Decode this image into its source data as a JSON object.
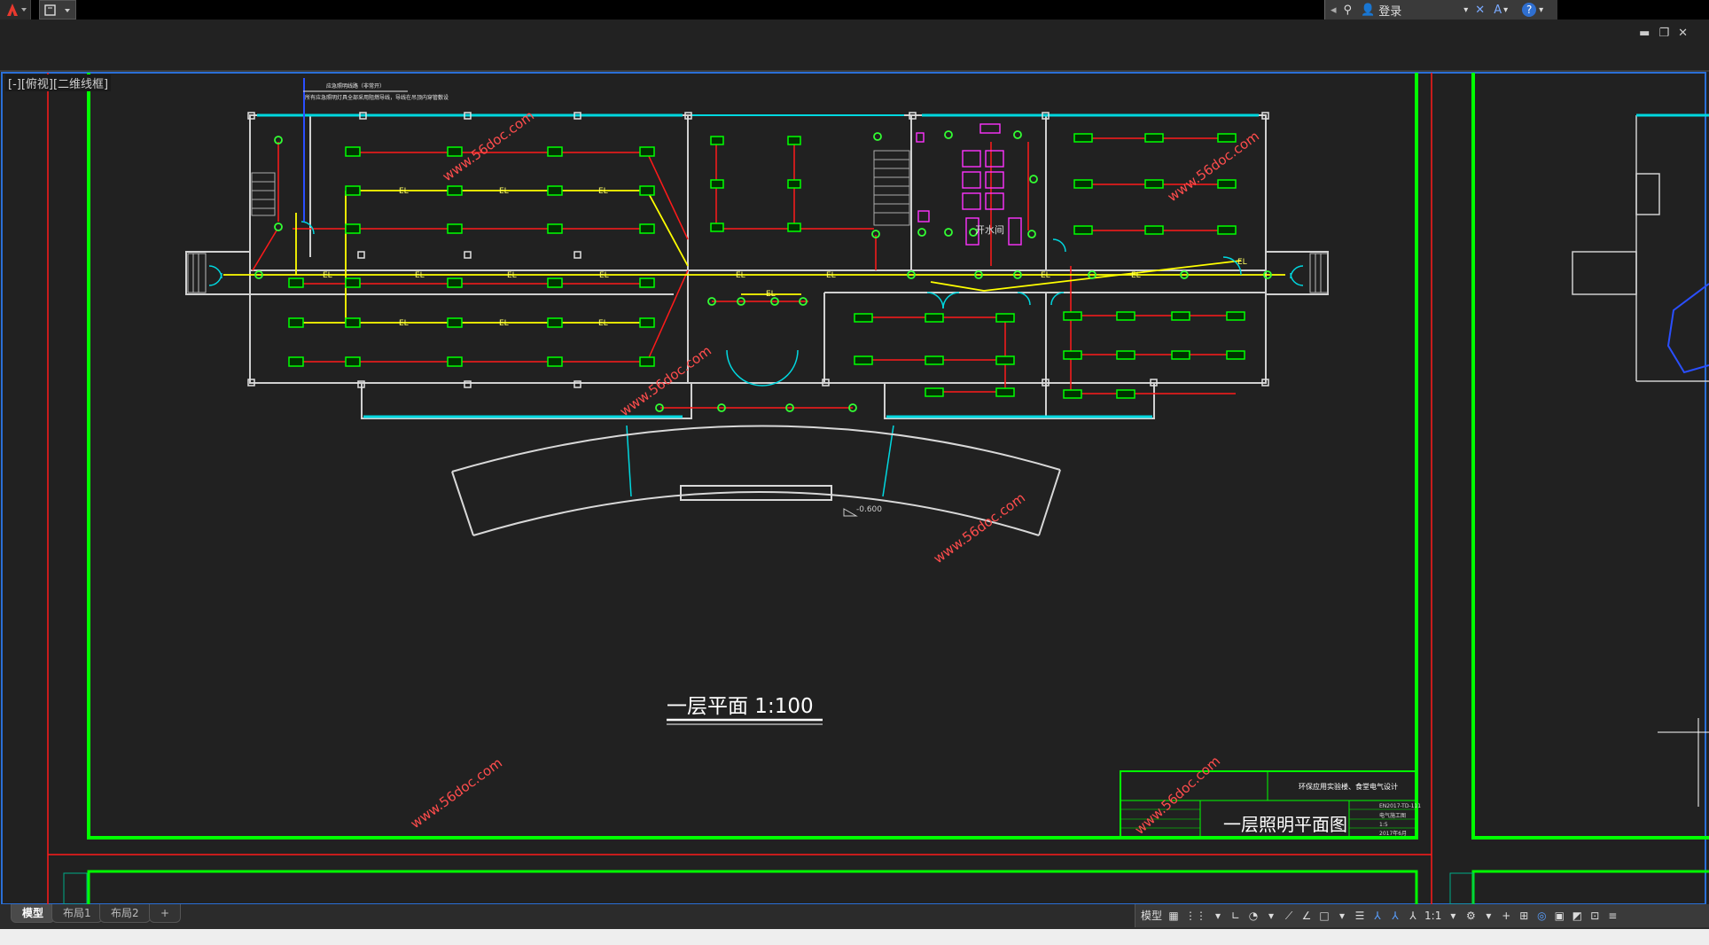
{
  "app": {
    "login_label": "登录",
    "help_icon": "help-icon",
    "window_controls": [
      "▬",
      "❐",
      "✕"
    ]
  },
  "viewport": {
    "label": "[-][俯视][二维线框]"
  },
  "drawing": {
    "plan_title": "一层平面  1:100",
    "watermark": "www.56doc.com",
    "elevation": "-0.600",
    "note_line1": "应急照明线路（非常开）",
    "note_line2": "所有应急照明灯具全部采用阻燃导线，导线在吊顶内穿管敷设",
    "fixture_label": "EL",
    "room_label": "开水间",
    "title_block": {
      "project": "环保应用实验楼、食堂电气设计",
      "drawing_name": "一层照明平面图",
      "drawing_no": "EN2017-TD-111",
      "discipline": "电气施工图",
      "scale": "1:5",
      "date": "2017年6月"
    }
  },
  "tabs": [
    {
      "label": "模型",
      "active": true
    },
    {
      "label": "布局1",
      "active": false
    },
    {
      "label": "布局2",
      "active": false
    },
    {
      "label": "+",
      "active": false
    }
  ],
  "status": {
    "model_label": "模型",
    "scale": "1:1"
  },
  "colors": {
    "canvas": "#212121",
    "frame_green": "#00ff00",
    "frame_red": "#ff0000",
    "wall": "#d0d0d0",
    "cyan": "#00e0e0",
    "yellow": "#ffff00",
    "magenta": "#ff00ff",
    "fixture": "#00ff00"
  }
}
